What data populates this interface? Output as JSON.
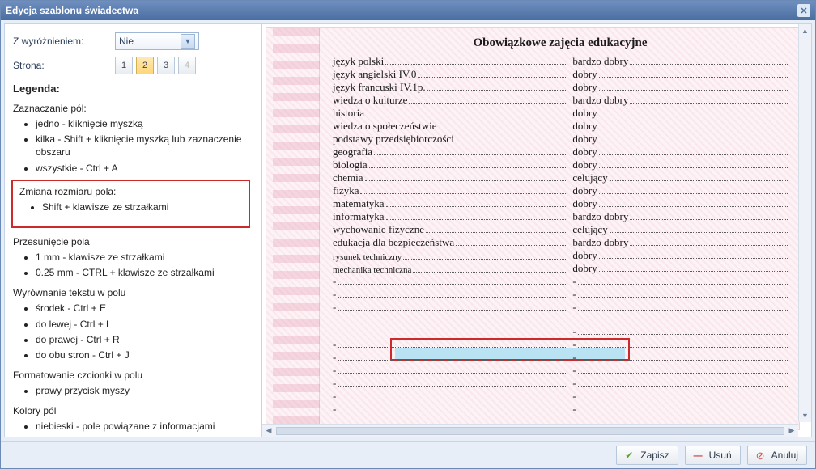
{
  "dialog": {
    "title": "Edycja szablonu świadectwa"
  },
  "form": {
    "distinction_label": "Z wyróżnieniem:",
    "distinction_value": "Nie",
    "page_label": "Strona:",
    "pages": [
      "1",
      "2",
      "3",
      "4"
    ],
    "active_page_index": 1
  },
  "legend": {
    "heading": "Legenda:",
    "sections": [
      {
        "title": "Zaznaczanie pól:",
        "items": [
          "jedno - kliknięcie myszką",
          "kilka - Shift + kliknięcie myszką lub zaznaczenie obszaru",
          "wszystkie - Ctrl + A"
        ]
      },
      {
        "title": "Zmiana rozmiaru pola:",
        "items": [
          "Shift + klawisze ze strzałkami"
        ],
        "highlighted": true
      },
      {
        "title": "Przesunięcie pola",
        "items": [
          "1 mm - klawisze ze strzałkami",
          "0.25 mm - CTRL + klawisze ze strzałkami"
        ]
      },
      {
        "title": "Wyrównanie tekstu w polu",
        "items": [
          "środek - Ctrl + E",
          "do lewej - Ctrl + L",
          "do prawej - Ctrl + R",
          "do obu stron - Ctrl + J"
        ]
      },
      {
        "title": "Formatowanie czcionki w polu",
        "items": [
          "prawy przycisk myszy"
        ]
      },
      {
        "title": "Kolory pól",
        "items": [
          "niebieski - pole powiązane z informacjami"
        ]
      }
    ]
  },
  "certificate": {
    "heading": "Obowiązkowe zajęcia edukacyjne",
    "rows": [
      {
        "subject": "język polski",
        "grade": "bardzo dobry"
      },
      {
        "subject": "język  angielski  IV.0",
        "grade": "dobry"
      },
      {
        "subject": "język  francuski  IV.1p.",
        "grade": "dobry"
      },
      {
        "subject": "wiedza o kulturze",
        "grade": "bardzo dobry"
      },
      {
        "subject": "historia",
        "grade": "dobry"
      },
      {
        "subject": "wiedza o społeczeństwie",
        "grade": "dobry"
      },
      {
        "subject": "podstawy przedsiębiorczości",
        "grade": "dobry"
      },
      {
        "subject": "geografia",
        "grade": "dobry"
      },
      {
        "subject": "biologia",
        "grade": "dobry"
      },
      {
        "subject": "chemia",
        "grade": "celujący"
      },
      {
        "subject": "fizyka",
        "grade": "dobry"
      },
      {
        "subject": "matematyka",
        "grade": "dobry"
      },
      {
        "subject": "informatyka",
        "grade": "bardzo dobry"
      },
      {
        "subject": "wychowanie fizyczne",
        "grade": "celujący"
      },
      {
        "subject": "edukacja dla bezpieczeństwa",
        "grade": "bardzo dobry"
      },
      {
        "subject": "rysunek techniczny",
        "grade": "dobry",
        "small": true
      },
      {
        "subject": "mechanika techniczna",
        "grade": "dobry",
        "small": true
      },
      {
        "subject": "-",
        "grade": "-"
      },
      {
        "subject": "-",
        "grade": "-"
      },
      {
        "subject": "-",
        "grade": "-"
      },
      {
        "subject": "-",
        "grade": "-",
        "selected": true
      },
      {
        "subject": "-",
        "grade": "-"
      },
      {
        "subject": "-",
        "grade": "-"
      },
      {
        "subject": "-",
        "grade": "-"
      },
      {
        "subject": "-",
        "grade": "-"
      },
      {
        "subject": "-",
        "grade": "-"
      },
      {
        "subject": "-",
        "grade": "-"
      }
    ]
  },
  "footer": {
    "save": "Zapisz",
    "delete": "Usuń",
    "cancel": "Anuluj"
  }
}
